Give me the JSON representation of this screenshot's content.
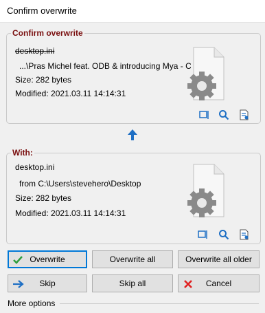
{
  "window": {
    "title": "Confirm overwrite"
  },
  "existing": {
    "legend": "Confirm overwrite",
    "filename": "desktop.ini",
    "path": "...\\Pras Michel feat. ODB & introducing Mya - C",
    "size": "Size:  282 bytes",
    "modified": "Modified:  2021.03.11 14:14:31"
  },
  "incoming": {
    "legend": "With:",
    "filename": "desktop.ini",
    "path": "from C:\\Users\\stevehero\\Desktop",
    "size": "Size:  282 bytes",
    "modified": "Modified:  2021.03.11 14:14:31"
  },
  "buttons": {
    "overwrite": "Overwrite",
    "overwrite_all": "Overwrite all",
    "overwrite_all_older": "Overwrite all older",
    "skip": "Skip",
    "skip_all": "Skip all",
    "cancel": "Cancel"
  },
  "more_options": "More options",
  "colors": {
    "accent": "#1e6fc4",
    "legend": "#7a1010",
    "cancel": "#e02020",
    "check": "#2e9e3e"
  }
}
